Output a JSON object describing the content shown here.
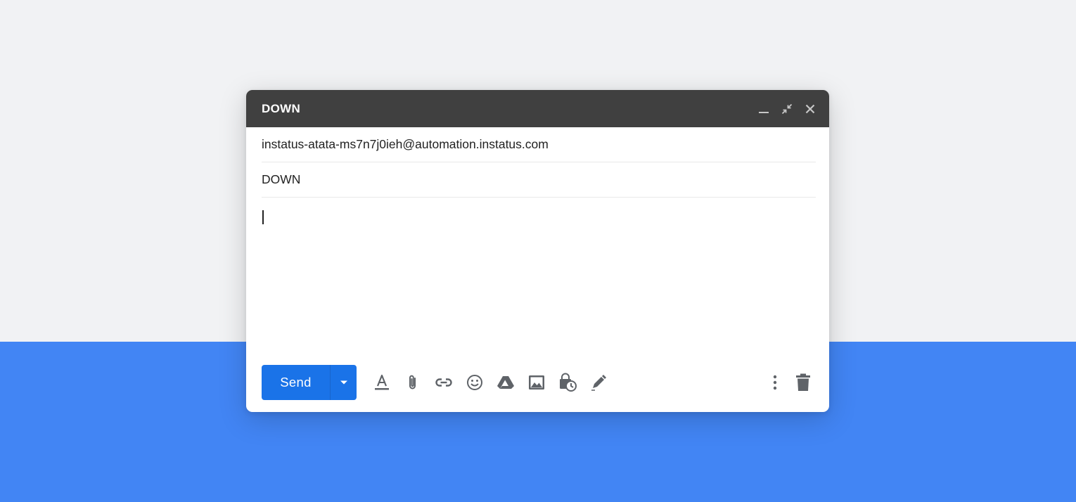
{
  "window": {
    "title": "DOWN"
  },
  "fields": {
    "to": "instatus-atata-ms7n7j0ieh@automation.instatus.com",
    "subject": "DOWN",
    "body": ""
  },
  "toolbar": {
    "send_label": "Send",
    "icons": [
      "formatting-icon",
      "attach-icon",
      "link-icon",
      "emoji-icon",
      "drive-icon",
      "photo-icon",
      "confidential-mode-icon",
      "signature-icon",
      "more-options-icon",
      "trash-icon"
    ]
  },
  "colors": {
    "page_background": "#f1f2f4",
    "accent_band": "#4285f4",
    "titlebar": "#404040",
    "send_button": "#1a73e8",
    "icon": "#5f6368"
  }
}
